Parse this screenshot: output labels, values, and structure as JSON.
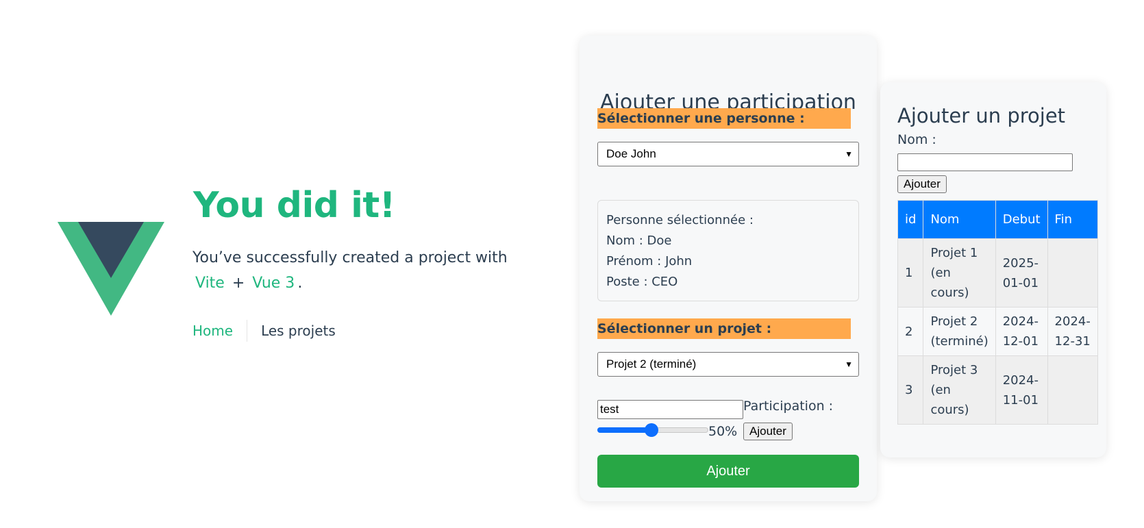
{
  "hero": {
    "title": "You did it!",
    "subtitle": "You’ve successfully created a project with",
    "link_vite": "Vite",
    "plus": "+",
    "link_vue": "Vue 3",
    "period": "."
  },
  "nav": {
    "home": "Home",
    "projets": "Les projets"
  },
  "participation": {
    "title": "Ajouter une participation",
    "select_person_label": "Sélectionner une personne :",
    "person_selected_value": "Doe John",
    "info": {
      "heading": "Personne sélectionnée :",
      "nom": "Nom : Doe",
      "prenom": "Prénom : John",
      "poste": "Poste : CEO"
    },
    "select_project_label": "Sélectionner un projet :",
    "project_selected_value": "Projet 2 (terminé)",
    "text_value": "test",
    "participation_label": "Participation :",
    "slider_value": 50,
    "slider_text": "50%",
    "small_button": "Ajouter",
    "main_button": "Ajouter"
  },
  "projet": {
    "title": "Ajouter un projet",
    "nom_label": "Nom :",
    "nom_value": "",
    "button": "Ajouter",
    "columns": [
      "id",
      "Nom",
      "Debut",
      "Fin"
    ],
    "rows": [
      {
        "id": "1",
        "nom": "Projet 1 (en cours)",
        "debut": "2025-01-01",
        "fin": ""
      },
      {
        "id": "2",
        "nom": "Projet 2 (terminé)",
        "debut": "2024-12-01",
        "fin": "2024-12-31"
      },
      {
        "id": "3",
        "nom": "Projet 3 (en cours)",
        "debut": "2024-11-01",
        "fin": ""
      }
    ]
  },
  "colors": {
    "vue_green": "#1fb67e",
    "vue_dark": "#35495e",
    "orange": "#ffa94d",
    "primary_blue": "#007bff",
    "success_green": "#28a745"
  }
}
